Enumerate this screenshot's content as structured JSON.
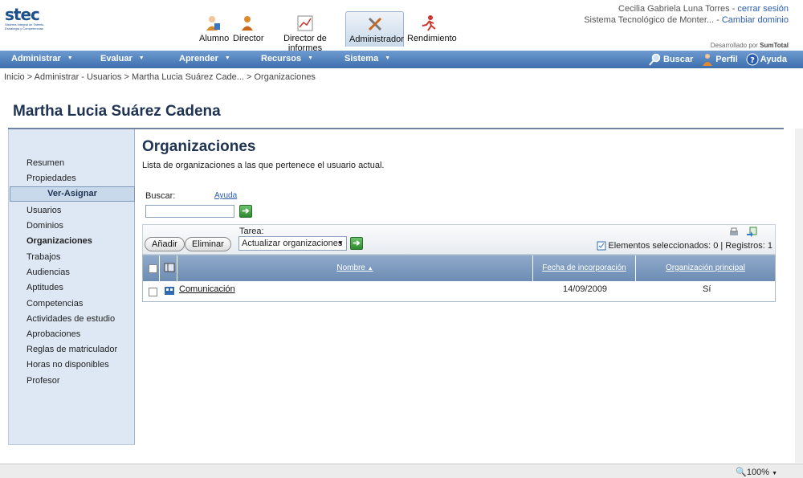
{
  "logo": {
    "brand": "stec",
    "tagline": "Sistema Integral de Talento, Estrategia y Competencias"
  },
  "roles": [
    {
      "label": "Alumno",
      "icon": "student-icon",
      "active": false
    },
    {
      "label": "Director",
      "icon": "director-icon",
      "active": false
    },
    {
      "label": "Director de informes",
      "icon": "report-chart-icon",
      "active": false
    },
    {
      "label": "Administrador",
      "icon": "tools-icon",
      "active": true
    },
    {
      "label": "Rendimiento",
      "icon": "runner-icon",
      "active": false
    }
  ],
  "user": {
    "name": "Cecilia Gabriela Luna Torres",
    "sep1": " - ",
    "logout": "cerrar sesión",
    "domain": "Sistema Tecnológico de Monter...",
    "sep2": " - ",
    "change_domain": "Cambiar dominio",
    "developed_by": "Desarrollado por",
    "vendor": "SumTotal"
  },
  "nav": {
    "items": [
      "Administrar",
      "Evaluar",
      "Aprender",
      "Recursos",
      "Sistema"
    ],
    "search": "Buscar",
    "profile": "Perfil",
    "help": "Ayuda"
  },
  "breadcrumb": "Inicio > Administrar - Usuarios > Martha Lucia Suárez Cade... > Organizaciones",
  "page_title": "Martha Lucia Suárez Cadena",
  "sidebar": {
    "top": [
      "Resumen",
      "Propiedades"
    ],
    "header": "Ver-Asignar",
    "items": [
      "Usuarios",
      "Dominios",
      "Organizaciones",
      "Trabajos",
      "Audiencias",
      "Aptitudes",
      "Competencias",
      "Actividades de estudio",
      "Aprobaciones",
      "Reglas de matriculador",
      "Horas no disponibles",
      "Profesor"
    ],
    "active_item": "Organizaciones"
  },
  "main": {
    "title": "Organizaciones",
    "description": "Lista de organizaciones a las que pertenece el usuario actual.",
    "search_label": "Buscar:",
    "help_link": "Ayuda",
    "search_value": "",
    "add_button": "Añadir",
    "delete_button": "Eliminar",
    "task_label": "Tarea:",
    "task_selected": "Actualizar organizaciones",
    "selection_info": "Elementos seleccionados: 0 | Registros: 1"
  },
  "grid": {
    "columns": [
      "Nombre",
      "Fecha de incorporación",
      "Organización principal"
    ],
    "sort_indicator": "▲",
    "rows": [
      {
        "name": "Comunicación",
        "date": "14/09/2009",
        "primary": "Sí"
      }
    ]
  },
  "status": {
    "zoom": "100%"
  },
  "colors": {
    "nav": "#3d6fae",
    "title": "#1f3352",
    "sidebar": "#dde8f4",
    "grid_header": "#7f9cc0"
  }
}
